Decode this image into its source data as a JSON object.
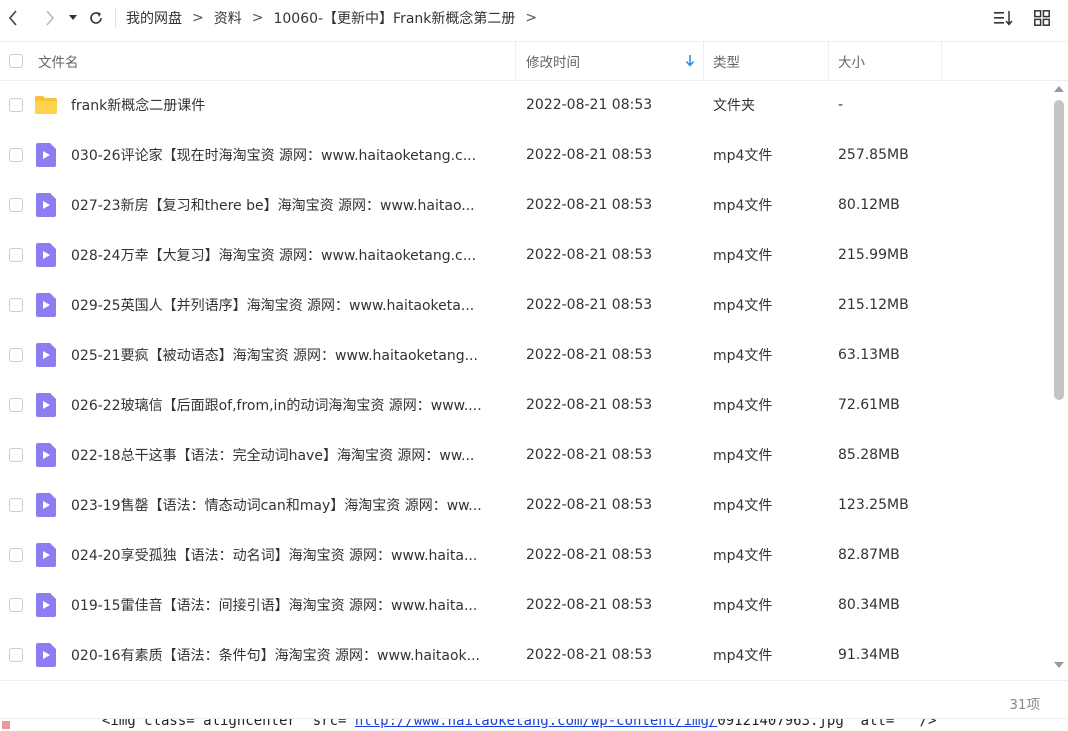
{
  "breadcrumb": [
    "我的网盘",
    "资料",
    "10060-【更新中】Frank新概念第二册"
  ],
  "breadcrumb_sep": ">",
  "columns": {
    "name": "文件名",
    "mtime": "修改时间",
    "type": "类型",
    "size": "大小"
  },
  "files": [
    {
      "name": "frank新概念二册课件",
      "mtime": "2022-08-21 08:53",
      "type": "文件夹",
      "size": "-",
      "icon": "folder-icon"
    },
    {
      "name": "030-26评论家【现在时海淘宝资 源网：www.haitaoketang.c...",
      "mtime": "2022-08-21 08:53",
      "type": "mp4文件",
      "size": "257.85MB",
      "icon": "video-file-icon"
    },
    {
      "name": "027-23新房【复习和there be】海淘宝资 源网：www.haitao...",
      "mtime": "2022-08-21 08:53",
      "type": "mp4文件",
      "size": "80.12MB",
      "icon": "video-file-icon"
    },
    {
      "name": "028-24万幸【大复习】海淘宝资 源网：www.haitaoketang.c...",
      "mtime": "2022-08-21 08:53",
      "type": "mp4文件",
      "size": "215.99MB",
      "icon": "video-file-icon"
    },
    {
      "name": "029-25英国人【并列语序】海淘宝资 源网：www.haitaoketa...",
      "mtime": "2022-08-21 08:53",
      "type": "mp4文件",
      "size": "215.12MB",
      "icon": "video-file-icon"
    },
    {
      "name": "025-21要疯【被动语态】海淘宝资 源网：www.haitaoketang...",
      "mtime": "2022-08-21 08:53",
      "type": "mp4文件",
      "size": "63.13MB",
      "icon": "video-file-icon"
    },
    {
      "name": "026-22玻璃信【后面跟of,from,in的动词海淘宝资 源网：www....",
      "mtime": "2022-08-21 08:53",
      "type": "mp4文件",
      "size": "72.61MB",
      "icon": "video-file-icon"
    },
    {
      "name": "022-18总干这事【语法：完全动词have】海淘宝资 源网：ww...",
      "mtime": "2022-08-21 08:53",
      "type": "mp4文件",
      "size": "85.28MB",
      "icon": "video-file-icon"
    },
    {
      "name": "023-19售罄【语法：情态动词can和may】海淘宝资 源网：ww...",
      "mtime": "2022-08-21 08:53",
      "type": "mp4文件",
      "size": "123.25MB",
      "icon": "video-file-icon"
    },
    {
      "name": "024-20享受孤独【语法：动名词】海淘宝资 源网：www.haita...",
      "mtime": "2022-08-21 08:53",
      "type": "mp4文件",
      "size": "82.87MB",
      "icon": "video-file-icon"
    },
    {
      "name": "019-15雷佳音【语法：间接引语】海淘宝资 源网：www.haita...",
      "mtime": "2022-08-21 08:53",
      "type": "mp4文件",
      "size": "80.34MB",
      "icon": "video-file-icon"
    },
    {
      "name": "020-16有素质【语法：条件句】海淘宝资 源网：www.haitaok...",
      "mtime": "2022-08-21 08:53",
      "type": "mp4文件",
      "size": "91.34MB",
      "icon": "video-file-icon"
    }
  ],
  "footer": {
    "count": "31项"
  },
  "bottom_strip": {
    "before": "<img class=\"aligncenter\" src=\"",
    "link": "http://www.haitaoketang.com/wp-content/img/",
    "after": "09121407963.jpg\" alt=\"\" />"
  },
  "colors": {
    "accent": "#2b8df5",
    "folder": "#f7c33b",
    "video": "#8c7ef0",
    "sort_arrow": "#2b8df5"
  }
}
